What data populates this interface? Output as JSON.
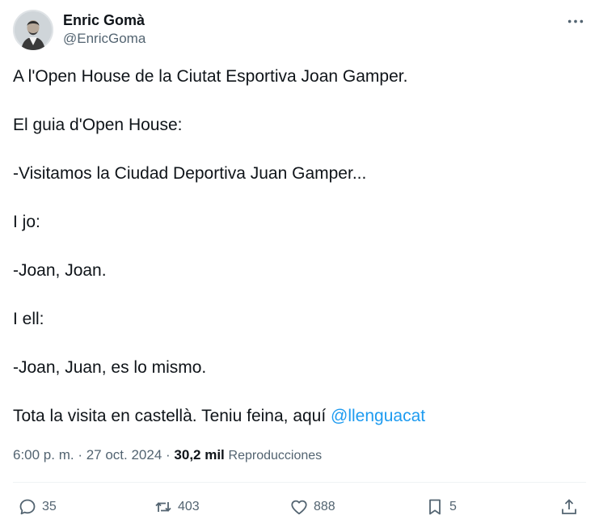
{
  "author": {
    "display_name": "Enric Gomà",
    "handle": "@EnricGoma"
  },
  "tweet": {
    "paragraphs": [
      "A l'Open House de la Ciutat Esportiva Joan Gamper.",
      "El guia d'Open House:",
      "-Visitamos la Ciudad Deportiva Juan Gamper...",
      "I jo:",
      "-Joan, Joan.",
      "I ell:",
      "-Joan, Juan, es lo mismo."
    ],
    "last_paragraph": "Tota la visita en castellà. Teniu feina, aquí ",
    "mention": "@llenguacat"
  },
  "meta": {
    "time": "6:00 p. m.",
    "separator": " · ",
    "date": "27 oct. 2024",
    "views_count": "30,2 mil",
    "views_label": "Reproducciones"
  },
  "actions": {
    "replies": "35",
    "reposts": "403",
    "likes": "888",
    "bookmarks": "5"
  },
  "icons": {
    "more": "more-horizontal-icon",
    "reply": "reply-icon",
    "repost": "repost-icon",
    "like": "heart-icon",
    "bookmark": "bookmark-icon",
    "share": "share-icon"
  },
  "colors": {
    "text": "#0f1419",
    "secondary": "#536471",
    "link": "#1d9bf0",
    "divider": "#eff3f4"
  }
}
